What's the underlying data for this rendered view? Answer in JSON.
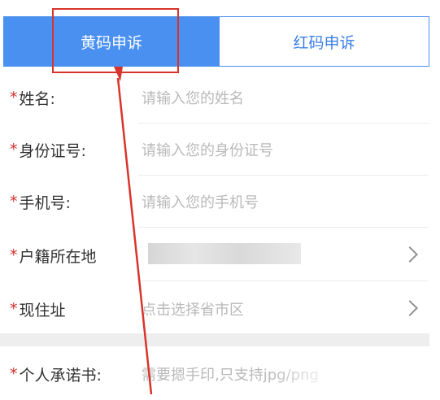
{
  "tabs": [
    {
      "label": "黄码申诉",
      "active": true
    },
    {
      "label": "红码申诉",
      "active": false
    }
  ],
  "fields": [
    {
      "label": "姓名:",
      "placeholder": "请输入您的姓名"
    },
    {
      "label": "身份证号:",
      "placeholder": "请输入您的身份证号"
    },
    {
      "label": "手机号:",
      "placeholder": "请输入您的手机号"
    },
    {
      "label": "户籍所在地",
      "placeholder": ""
    },
    {
      "label": "现住址",
      "placeholder": "点击选择省市区"
    },
    {
      "label": "个人承诺书:",
      "placeholder": "需要摁手印,只支持jpg/png"
    }
  ],
  "required_mark": "*",
  "colors": {
    "accent": "#4a90f0",
    "required": "#d0312d",
    "annotation": "#d9342b"
  }
}
